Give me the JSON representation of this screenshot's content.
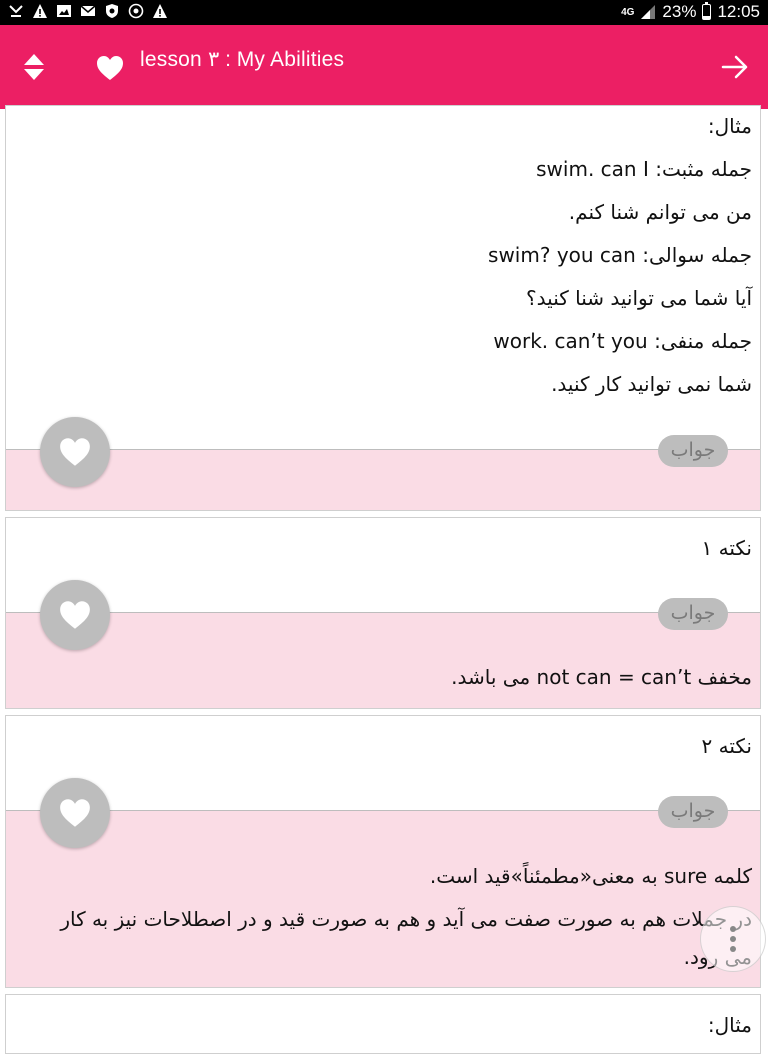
{
  "status_bar": {
    "network": "4G",
    "battery": "23%",
    "battery_level": 0.23,
    "time": "12:05"
  },
  "appbar": {
    "title": "lesson ٣ : My Abilities",
    "icons": [
      "sort-updown-icon",
      "heart-icon",
      "arrow-right-icon"
    ]
  },
  "cards": [
    {
      "lines": [
        "مثال:",
        "جمله مثبت: swim. can I",
        "من می توانم شنا کنم.",
        "جمله سوالی: swim? you can",
        "آیا شما می توانید شنا کنید؟",
        "جمله منفی: work. can’t you",
        "شما نمی توانید کار کنید."
      ],
      "answer_label": "جواب",
      "answer_lines": []
    },
    {
      "lines": [
        "نکته ١"
      ],
      "answer_label": "جواب",
      "answer_lines": [
        "مخفف not can = can’t می باشد."
      ]
    },
    {
      "lines": [
        "نکته ٢"
      ],
      "answer_label": "جواب",
      "answer_lines": [
        "کلمه sure به معنی«مطمئناً»قید است.",
        "در جملات هم به صورت صفت می آید و هم به صورت قید و در اصطلاحات نیز به کار",
        "می رود."
      ]
    },
    {
      "lines": [
        "مثال:"
      ]
    }
  ]
}
